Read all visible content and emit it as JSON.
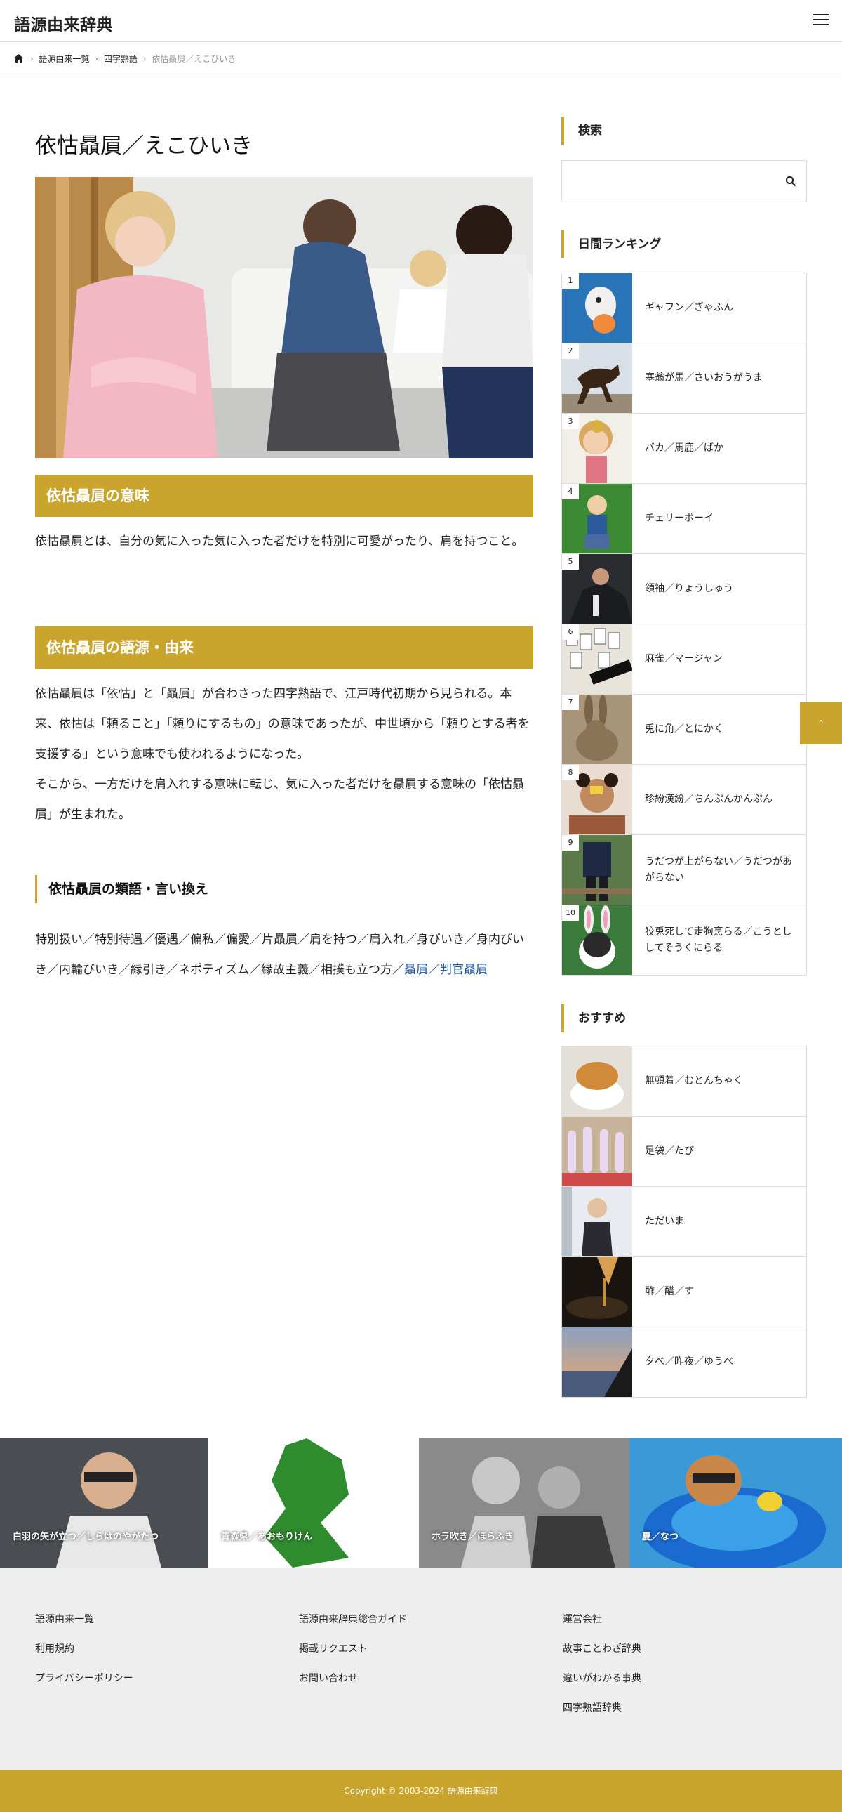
{
  "header": {
    "site_title": "語源由来辞典"
  },
  "breadcrumb": {
    "items": [
      "語源由来一覧",
      "四字熟語"
    ],
    "current": "依怙贔屓／えこひいき"
  },
  "article": {
    "title": "依怙贔屓／えこひいき",
    "meaning_heading": "依怙贔屓の意味",
    "meaning_text": "依怙贔屓とは、自分の気に入った気に入った者だけを特別に可愛がったり、肩を持つこと。",
    "origin_heading": "依怙贔屓の語源・由来",
    "origin_text_1": "依怙贔屓は「依怙」と「贔屓」が合わさった四字熟語で、江戸時代初期から見られる。本来、依怙は「頼ること」「頼りにするもの」の意味であったが、中世頃から「頼りとする者を支援する」という意味でも使われるようになった。",
    "origin_text_2": "そこから、一方だけを肩入れする意味に転じ、気に入った者だけを贔屓する意味の「依怙贔屓」が生まれた。",
    "synonyms_heading": "依怙贔屓の類語・言い換え",
    "synonyms_text": "特別扱い／特別待遇／優遇／偏私／偏愛／片贔屓／肩を持つ／肩入れ／身びいき／身内びいき／内輪びいき／縁引き／ネポティズム／縁故主義／相撲も立つ方／",
    "synonyms_link_1": "贔屓",
    "synonyms_sep": "／",
    "synonyms_link_2": "判官贔屓"
  },
  "sidebar": {
    "search_heading": "検索",
    "search_placeholder": "",
    "ranking_heading": "日間ランキング",
    "ranking": [
      {
        "rank": "1",
        "label": "ギャフン／ぎゃふん"
      },
      {
        "rank": "2",
        "label": "塞翁が馬／さいおうがうま"
      },
      {
        "rank": "3",
        "label": "バカ／馬鹿／ばか"
      },
      {
        "rank": "4",
        "label": "チェリーボーイ"
      },
      {
        "rank": "5",
        "label": "領袖／りょうしゅう"
      },
      {
        "rank": "6",
        "label": "麻雀／マージャン"
      },
      {
        "rank": "7",
        "label": "兎に角／とにかく"
      },
      {
        "rank": "8",
        "label": "珍紛漢紛／ちんぷんかんぷん"
      },
      {
        "rank": "9",
        "label": "うだつが上がらない／うだつがあがらない"
      },
      {
        "rank": "10",
        "label": "狡兎死して走狗烹らる／こうとししてそうくにらる"
      }
    ],
    "recommend_heading": "おすすめ",
    "recommend": [
      {
        "label": "無頓着／むとんちゃく"
      },
      {
        "label": "足袋／たび"
      },
      {
        "label": "ただいま"
      },
      {
        "label": "酢／醋／す"
      },
      {
        "label": "夕べ／昨夜／ゆうべ"
      }
    ]
  },
  "features": [
    {
      "label": "白羽の矢が立つ／しらはのやがたつ"
    },
    {
      "label": "青森県／あおもりけん"
    },
    {
      "label": "ホラ吹き／ほらふき"
    },
    {
      "label": "夏／なつ"
    }
  ],
  "footer": {
    "col1": [
      "語源由来一覧",
      "利用規約",
      "プライバシーポリシー"
    ],
    "col2": [
      "語源由来辞典総合ガイド",
      "掲載リクエスト",
      "お問い合わせ"
    ],
    "col3": [
      "運営会社",
      "故事ことわざ辞典",
      "違いがわかる事典",
      "四字熟語辞典"
    ],
    "copyright": "Copyright © 2003-2024 語源由来辞典"
  },
  "colors": {
    "accent": "#c9a52d",
    "link": "#2255a0",
    "border": "#dddddd",
    "footer_bg": "#eeeeee"
  },
  "icons": {
    "menu": "hamburger-icon",
    "home": "home-icon",
    "search": "search-icon",
    "pagetop": "chevron-up-icon"
  }
}
